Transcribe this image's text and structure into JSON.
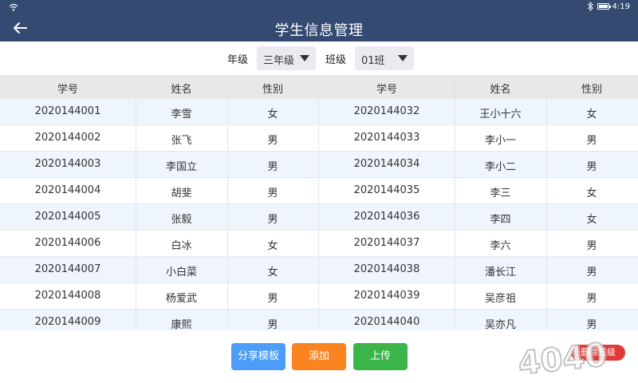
{
  "status": {
    "time": "4:19"
  },
  "header": {
    "title": "学生信息管理"
  },
  "filters": {
    "grade_label": "年级",
    "grade_value": "三年级",
    "class_label": "班级",
    "class_value": "01班"
  },
  "table": {
    "headers": [
      "学号",
      "姓名",
      "性别",
      "学号",
      "姓名",
      "性别"
    ],
    "rows": [
      {
        "left": [
          "2020144001",
          "李雪",
          "女"
        ],
        "right": [
          "2020144032",
          "王小十六",
          "女"
        ]
      },
      {
        "left": [
          "2020144002",
          "张飞",
          "男"
        ],
        "right": [
          "2020144033",
          "李小一",
          "男"
        ]
      },
      {
        "left": [
          "2020144003",
          "李国立",
          "男"
        ],
        "right": [
          "2020144034",
          "李小二",
          "男"
        ]
      },
      {
        "left": [
          "2020144004",
          "胡斐",
          "男"
        ],
        "right": [
          "2020144035",
          "李三",
          "女"
        ]
      },
      {
        "left": [
          "2020144005",
          "张毅",
          "男"
        ],
        "right": [
          "2020144036",
          "李四",
          "女"
        ]
      },
      {
        "left": [
          "2020144006",
          "白冰",
          "女"
        ],
        "right": [
          "2020144037",
          "李六",
          "男"
        ]
      },
      {
        "left": [
          "2020144007",
          "小白菜",
          "女"
        ],
        "right": [
          "2020144038",
          "潘长江",
          "男"
        ]
      },
      {
        "left": [
          "2020144008",
          "杨爱武",
          "男"
        ],
        "right": [
          "2020144039",
          "吴彦祖",
          "男"
        ]
      },
      {
        "left": [
          "2020144009",
          "康熙",
          "男"
        ],
        "right": [
          "2020144040",
          "吴亦凡",
          "男"
        ]
      }
    ]
  },
  "footer": {
    "share_label": "分享模板",
    "add_label": "添加",
    "upload_label": "上传",
    "delete_label": "删除班级"
  },
  "colors": {
    "header_bg": "#344a70",
    "row_alt_bg": "#eef5fd",
    "share_btn": "#4b9df7",
    "add_btn": "#fb8320",
    "upload_btn": "#3bb549",
    "delete_btn": "#e23a3a"
  },
  "icons": [
    "wifi-icon",
    "bluetooth-icon",
    "battery-icon",
    "back-arrow-icon",
    "dropdown-caret-icon"
  ]
}
